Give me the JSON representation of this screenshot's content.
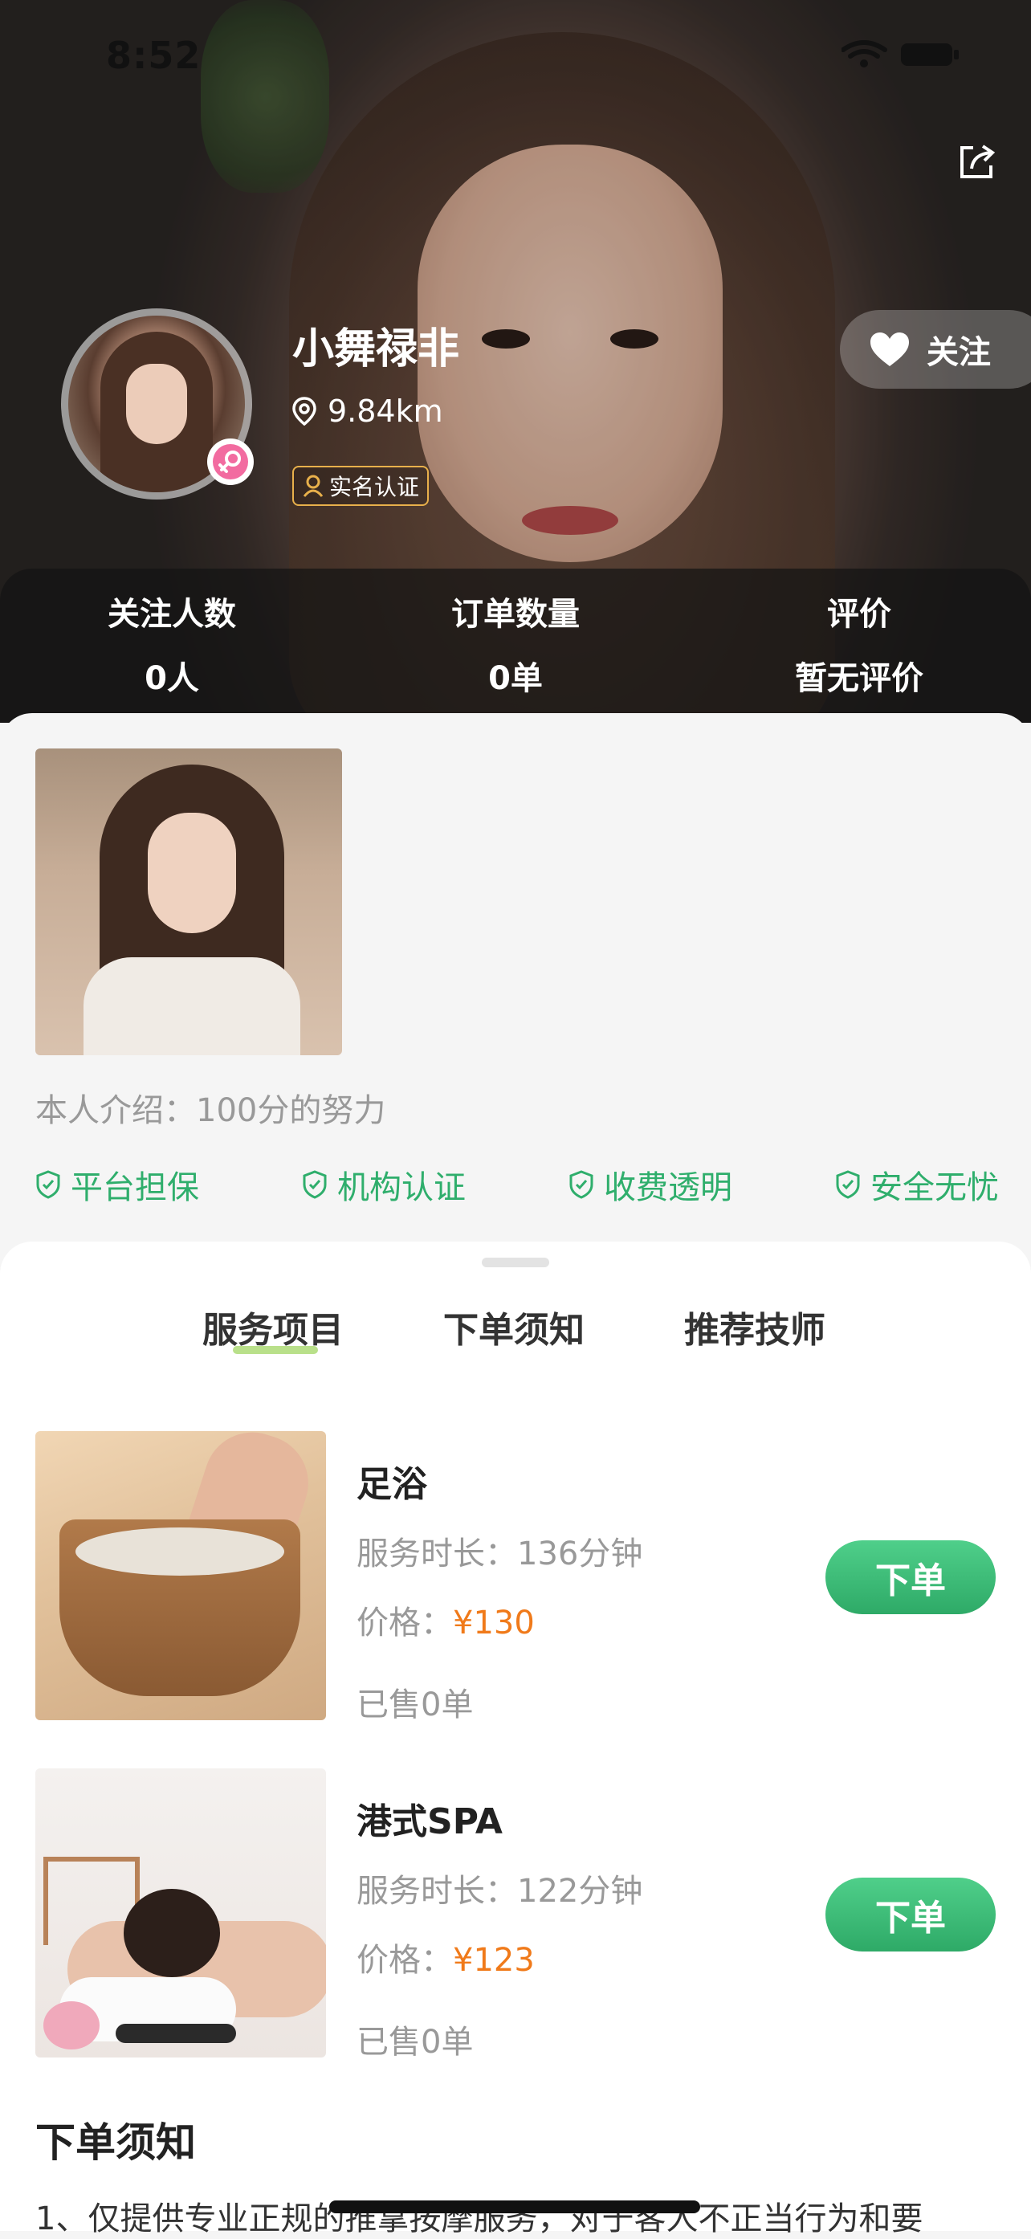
{
  "status_bar": {
    "time": "8:52"
  },
  "profile": {
    "name": "小舞禄非",
    "distance": "9.84km",
    "auth_tag": "实名认证",
    "follow_label": "关注"
  },
  "stats": [
    {
      "label": "关注人数",
      "value": "0人"
    },
    {
      "label": "订单数量",
      "value": "0单"
    },
    {
      "label": "评价",
      "value": "暂无评价"
    }
  ],
  "intro": "本人介绍：100分的努力",
  "guarantees": [
    "平台担保",
    "机构认证",
    "收费透明",
    "安全无忧"
  ],
  "tabs": [
    {
      "label": "服务项目",
      "active": true
    },
    {
      "label": "下单须知",
      "active": false
    },
    {
      "label": "推荐技师",
      "active": false
    }
  ],
  "services": [
    {
      "title": "足浴",
      "duration": "服务时长：136分钟",
      "price_label": "价格：",
      "price": "¥130",
      "sold": "已售0单",
      "button": "下单"
    },
    {
      "title": "港式SPA",
      "duration": "服务时长：122分钟",
      "price_label": "价格：",
      "price": "¥123",
      "sold": "已售0单",
      "button": "下单"
    }
  ],
  "notice": {
    "title": "下单须知",
    "text": "1、仅提供专业正规的推拿按摩服务，对于客人不正当行为和要"
  },
  "colors": {
    "accent_green": "#2fae6c",
    "price_orange": "#f07a1a",
    "tab_underline": "#b9e08a"
  }
}
